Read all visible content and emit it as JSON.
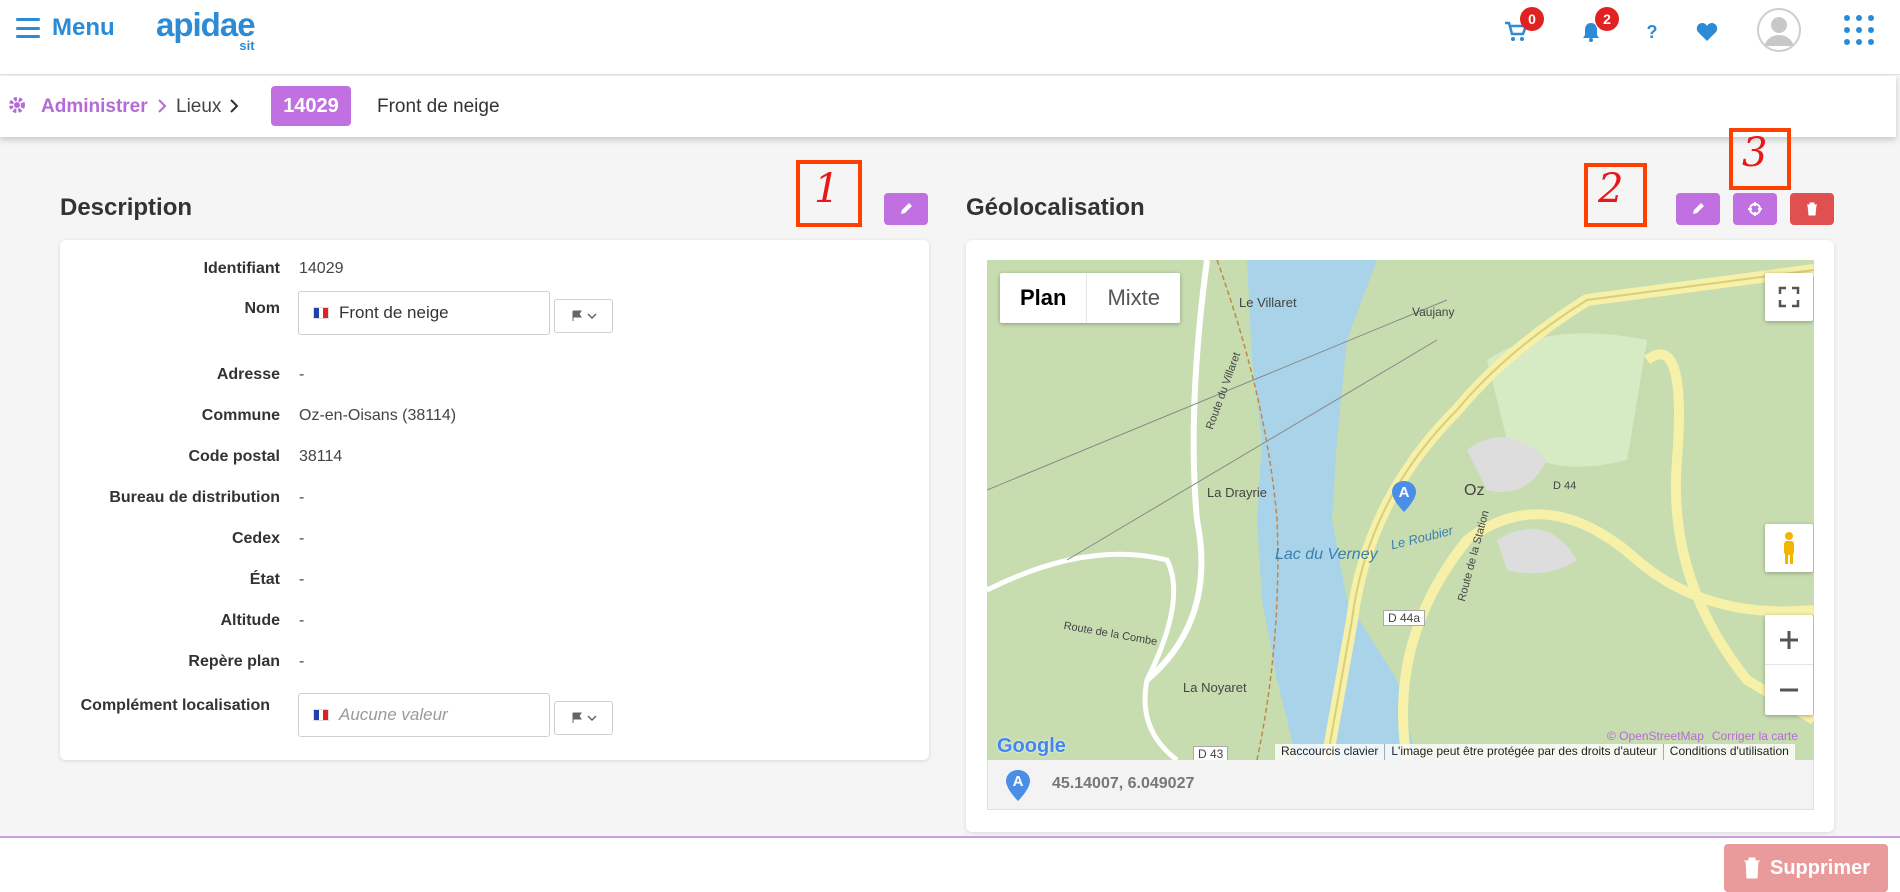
{
  "header": {
    "menu_label": "Menu",
    "logo_main": "apidae",
    "logo_sub": "sit",
    "cart_count": "0",
    "notif_count": "2",
    "help_label": "?"
  },
  "breadcrumb": {
    "admin": "Administrer",
    "lieux": "Lieux",
    "id": "14029",
    "name": "Front de neige"
  },
  "annotations": [
    "1",
    "2",
    "3"
  ],
  "description": {
    "title": "Description",
    "rows": [
      {
        "label": "Identifiant",
        "value": "14029"
      },
      {
        "label": "Nom",
        "value": "Front de neige"
      },
      {
        "label": "Adresse",
        "value": "-"
      },
      {
        "label": "Commune",
        "value": "Oz-en-Oisans (38114)"
      },
      {
        "label": "Code postal",
        "value": "38114"
      },
      {
        "label": "Bureau de distribution",
        "value": "-"
      },
      {
        "label": "Cedex",
        "value": "-"
      },
      {
        "label": "État",
        "value": "-"
      },
      {
        "label": "Altitude",
        "value": "-"
      },
      {
        "label": "Repère plan",
        "value": "-"
      },
      {
        "label": "Complément localisation",
        "placeholder": "Aucune valeur"
      }
    ]
  },
  "geoloc": {
    "title": "Géolocalisation",
    "map_type_plan": "Plan",
    "map_type_mixte": "Mixte",
    "marker_letter": "A",
    "labels": {
      "villaret": "Le Villaret",
      "drayrie": "La Drayrie",
      "noyaret": "La Noyaret",
      "oz": "Oz",
      "lac": "Lac du Verney",
      "roubier": "Le Roubier",
      "d44a": "D 44a",
      "d43": "D 43",
      "d44": "D 44",
      "vaujany": "Vaujany",
      "route_station": "Route de la Station",
      "route_villaret": "Route du Villaret",
      "route_combe": "Route de la Combe"
    },
    "footer_google": "Google",
    "footer_links": [
      "Raccourcis clavier",
      "L'image peut être protégée par des droits d'auteur",
      "Conditions d'utilisation"
    ],
    "attribution": "© OpenStreetMap",
    "correct_map": "Corriger la carte",
    "coordinates": "45.14007, 6.049027"
  },
  "bottom": {
    "delete_label": "Supprimer"
  }
}
